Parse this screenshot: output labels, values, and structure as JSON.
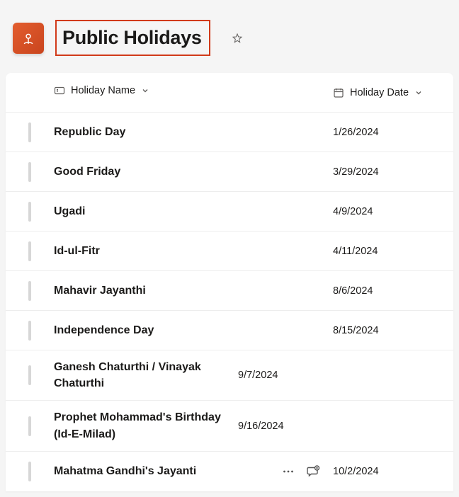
{
  "header": {
    "title": "Public Holidays"
  },
  "columns": {
    "name": "Holiday Name",
    "date": "Holiday Date"
  },
  "rows": [
    {
      "name": "Republic Day",
      "date": "1/26/2024"
    },
    {
      "name": "Good Friday",
      "date": "3/29/2024"
    },
    {
      "name": "Ugadi",
      "date": "4/9/2024"
    },
    {
      "name": "Id-ul-Fitr",
      "date": "4/11/2024"
    },
    {
      "name": "Mahavir Jayanthi",
      "date": "8/6/2024"
    },
    {
      "name": "Independence Day",
      "date": "8/15/2024"
    },
    {
      "name": "Ganesh Chaturthi / Vinayak Chaturthi",
      "date": "9/7/2024"
    },
    {
      "name": "Prophet Mohammad's Birthday (Id-E-Milad)",
      "date": "9/16/2024"
    },
    {
      "name": "Mahatma Gandhi's Jayanti",
      "date": "10/2/2024"
    }
  ]
}
